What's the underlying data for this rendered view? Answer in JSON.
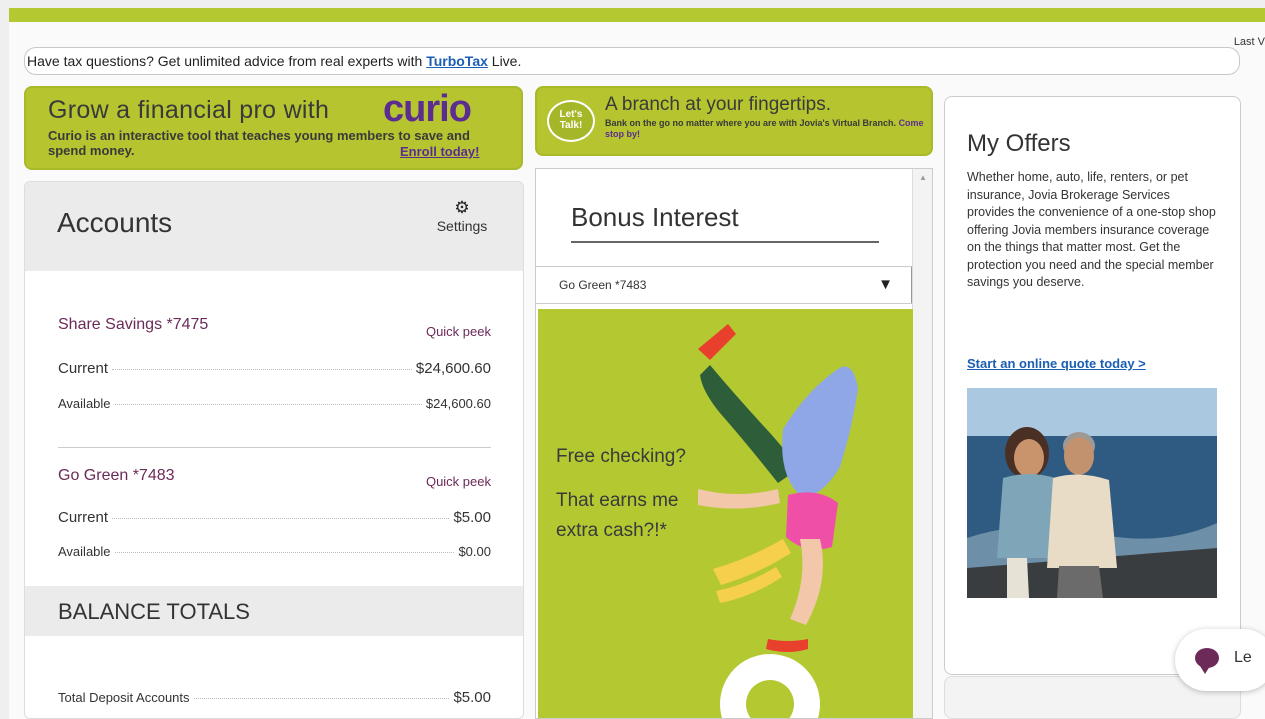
{
  "header": {
    "last_login_label": "Last V"
  },
  "tax_banner": {
    "text": "Have tax questions? Get unlimited advice from real experts with ",
    "link": "TurboTax",
    "suffix": " Live."
  },
  "curio_ad": {
    "title": "Grow a financial pro with",
    "logo": "curio",
    "subtitle": "Curio is an interactive tool that teaches young members to save and spend money.",
    "enroll_link": "Enroll today!"
  },
  "branch_ad": {
    "bubble": "Let's Talk!",
    "title": "A branch at your fingertips.",
    "subtitle": "Bank on the go no matter where you are with Jovia's Virtual Branch.",
    "link": "Come stop by!"
  },
  "accounts": {
    "title": "Accounts",
    "settings_label": "Settings",
    "items": [
      {
        "name": "Share Savings  *7475",
        "quick_peek": "Quick peek",
        "current_label": "Current",
        "current": "$24,600.60",
        "available_label": "Available",
        "available": "$24,600.60"
      },
      {
        "name": "Go Green  *7483",
        "quick_peek": "Quick peek",
        "current_label": "Current",
        "current": "$5.00",
        "available_label": "Available",
        "available": "$0.00"
      }
    ],
    "totals": {
      "title": "BALANCE TOTALS",
      "rows": [
        {
          "label": "Total Deposit Accounts",
          "value": "$5.00"
        }
      ]
    }
  },
  "bonus": {
    "title": "Bonus Interest",
    "selected_account": "Go Green *7483",
    "promo_line1": "Free checking?",
    "promo_line2": "That earns me extra cash?!*"
  },
  "offers": {
    "title": "My Offers",
    "body": "Whether home, auto, life, renters, or pet insurance, Jovia Brokerage Services provides the convenience of a one-stop shop offering Jovia members insurance coverage on the things that matter most. Get the protection you need and the special member savings you deserve.",
    "link": "Start an online quote today >"
  },
  "chat": {
    "label": "Le"
  },
  "colors": {
    "brand_green": "#b4c832",
    "brand_purple": "#5c2d91",
    "account_purple": "#6b2a58",
    "link_blue": "#1a5fb4"
  }
}
